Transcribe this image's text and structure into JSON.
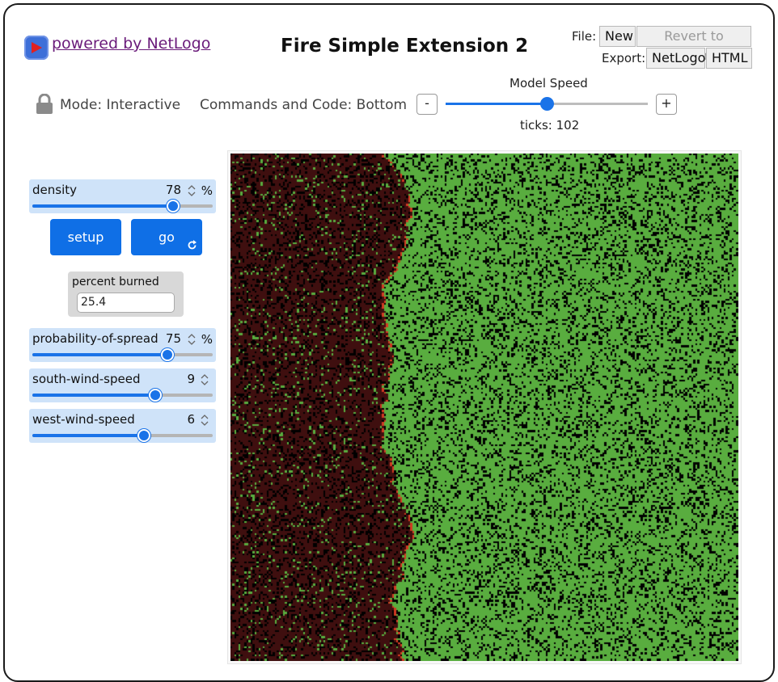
{
  "header": {
    "powered_by": "powered by NetLogo",
    "title": "Fire Simple Extension 2",
    "file_label": "File:",
    "new_label": "New",
    "revert_label": "Revert to Original",
    "export_label": "Export:",
    "export_netlogo": "NetLogo",
    "export_html": "HTML"
  },
  "modebar": {
    "mode": "Mode: Interactive",
    "commands": "Commands and Code: Bottom",
    "speed_title": "Model Speed",
    "minus": "-",
    "plus": "+",
    "speed_fraction": 0.5,
    "ticks": "ticks: 102"
  },
  "widgets": {
    "density": {
      "label": "density",
      "value": "78",
      "unit": "%",
      "min": 0,
      "max": 99,
      "fraction": 0.78
    },
    "setup_label": "setup",
    "go_label": "go",
    "percent_burned": {
      "label": "percent burned",
      "value": "25.4"
    },
    "probability": {
      "label": "probability-of-spread",
      "value": "75",
      "unit": "%",
      "fraction": 0.75
    },
    "south_wind": {
      "label": "south-wind-speed",
      "value": "9",
      "min": -25,
      "max": 25,
      "fraction": 0.68
    },
    "west_wind": {
      "label": "west-wind-speed",
      "value": "6",
      "min": -25,
      "max": 25,
      "fraction": 0.62
    }
  },
  "world": {
    "patch_grid": [
      251,
      251
    ],
    "colors": {
      "burned": "#3f0f0f",
      "tree": "#59ad3f",
      "empty": "#000000",
      "fire": "#d23a22"
    }
  },
  "colors": {
    "accent": "#1a73e8",
    "button": "#0f6fe6",
    "widget_bg": "#cfe3f9",
    "monitor_bg": "#d8d8d8",
    "link": "#6a1b7a"
  }
}
